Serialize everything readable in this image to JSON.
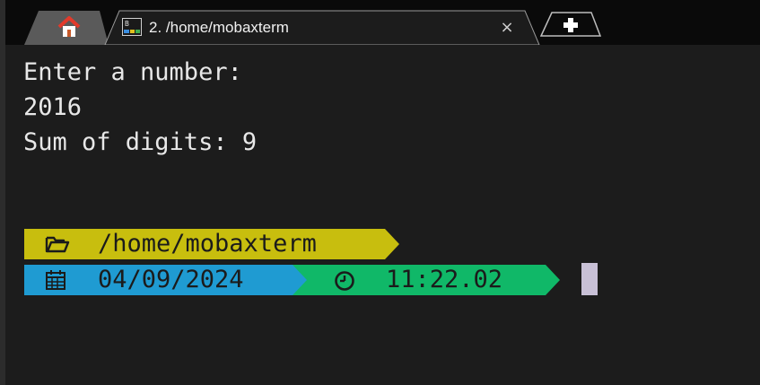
{
  "tabs": {
    "home_icon": "home-icon",
    "active_tab_title": "2. /home/mobaxterm",
    "close_glyph": "×",
    "new_tab_icon": "plus-icon"
  },
  "terminal": {
    "lines": [
      "Enter a number:",
      "2016",
      "Sum of digits: 9"
    ],
    "prompt": {
      "path": "/home/mobaxterm",
      "date": "04/09/2024",
      "time": "11:22.02"
    }
  },
  "colors": {
    "background": "#1c1c1c",
    "path_segment": "#c8be0e",
    "date_segment": "#1f9bd2",
    "time_segment": "#10b868",
    "cursor": "#c8c0d6"
  }
}
